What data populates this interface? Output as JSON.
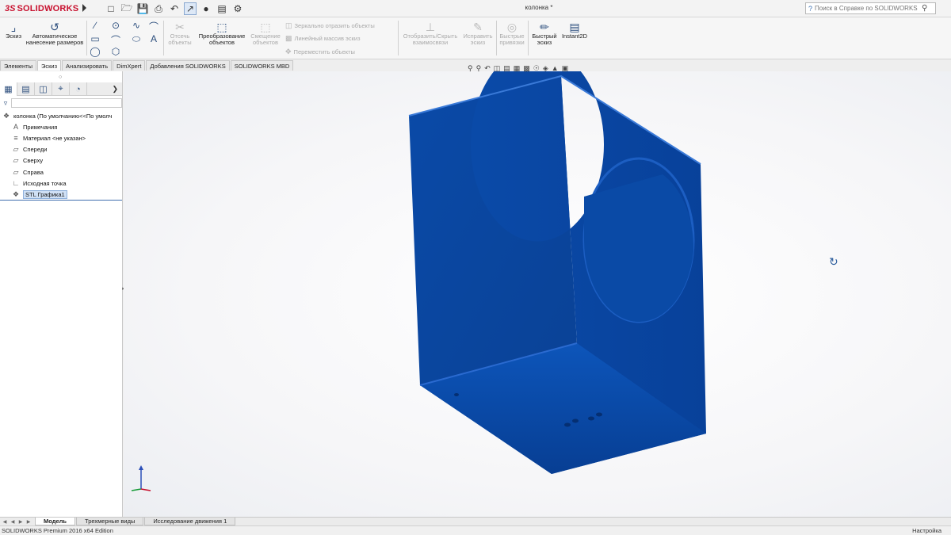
{
  "app": {
    "logo_prefix": "3S",
    "logo_text": "SOLIDWORKS",
    "document_title": "колонка *",
    "help_search_placeholder": "Поиск в Справке по SOLIDWORKS"
  },
  "quick_access": [
    "new-icon",
    "open-icon",
    "save-icon",
    "print-icon",
    "undo-icon",
    "select-icon",
    "rebuild-icon",
    "file-properties-icon",
    "options-icon"
  ],
  "ribbon": {
    "sketch": "Эскиз",
    "smart_dimension": "Автоматическое нанесение размеров",
    "trim_entities": "Отсечь объекты",
    "convert_entities": "Преобразование объектов",
    "offset_entities": "Смещение объектов",
    "mirror_entities": "Зеркально отразить объекты",
    "linear_pattern": "Линейный массив эскиз",
    "move_entities": "Переместить объекты",
    "display_delete_relations": "Отобразить/Скрыть взаимосвязи",
    "repair_sketch": "Исправить эскиз",
    "quick_snaps": "Быстрые привязки",
    "rapid_sketch": "Быстрый эскиз",
    "instant2d": "Instant2D"
  },
  "command_tabs": [
    {
      "label": "Элементы",
      "active": false
    },
    {
      "label": "Эскиз",
      "active": true
    },
    {
      "label": "Анализировать",
      "active": false
    },
    {
      "label": "DimXpert",
      "active": false
    },
    {
      "label": "Добавления SOLIDWORKS",
      "active": false
    },
    {
      "label": "SOLIDWORKS MBD",
      "active": false
    }
  ],
  "feature_tree": {
    "root": "колонка  (По умолчанию<<По умолч",
    "items": [
      {
        "label": "Примечания",
        "icon": "annotations-icon"
      },
      {
        "label": "Материал <не указан>",
        "icon": "material-icon"
      },
      {
        "label": "Спереди",
        "icon": "plane-icon"
      },
      {
        "label": "Сверху",
        "icon": "plane-icon"
      },
      {
        "label": "Справа",
        "icon": "plane-icon"
      },
      {
        "label": "Исходная точка",
        "icon": "origin-icon"
      },
      {
        "label": "STL Графика1",
        "icon": "stl-graphics-icon",
        "selected": true
      }
    ]
  },
  "bottom_tabs": [
    {
      "label": "Модель",
      "active": true
    },
    {
      "label": "Трехмерные виды",
      "active": false
    },
    {
      "label": "Исследование движения 1",
      "active": false
    }
  ],
  "status": {
    "left": "SOLIDWORKS Premium 2016 x64 Edition",
    "right": "Настройка"
  },
  "colors": {
    "model": "#0a47a3",
    "model_dark": "#063a8a",
    "model_light": "#2d6fd0",
    "accent": "#c8102e"
  }
}
